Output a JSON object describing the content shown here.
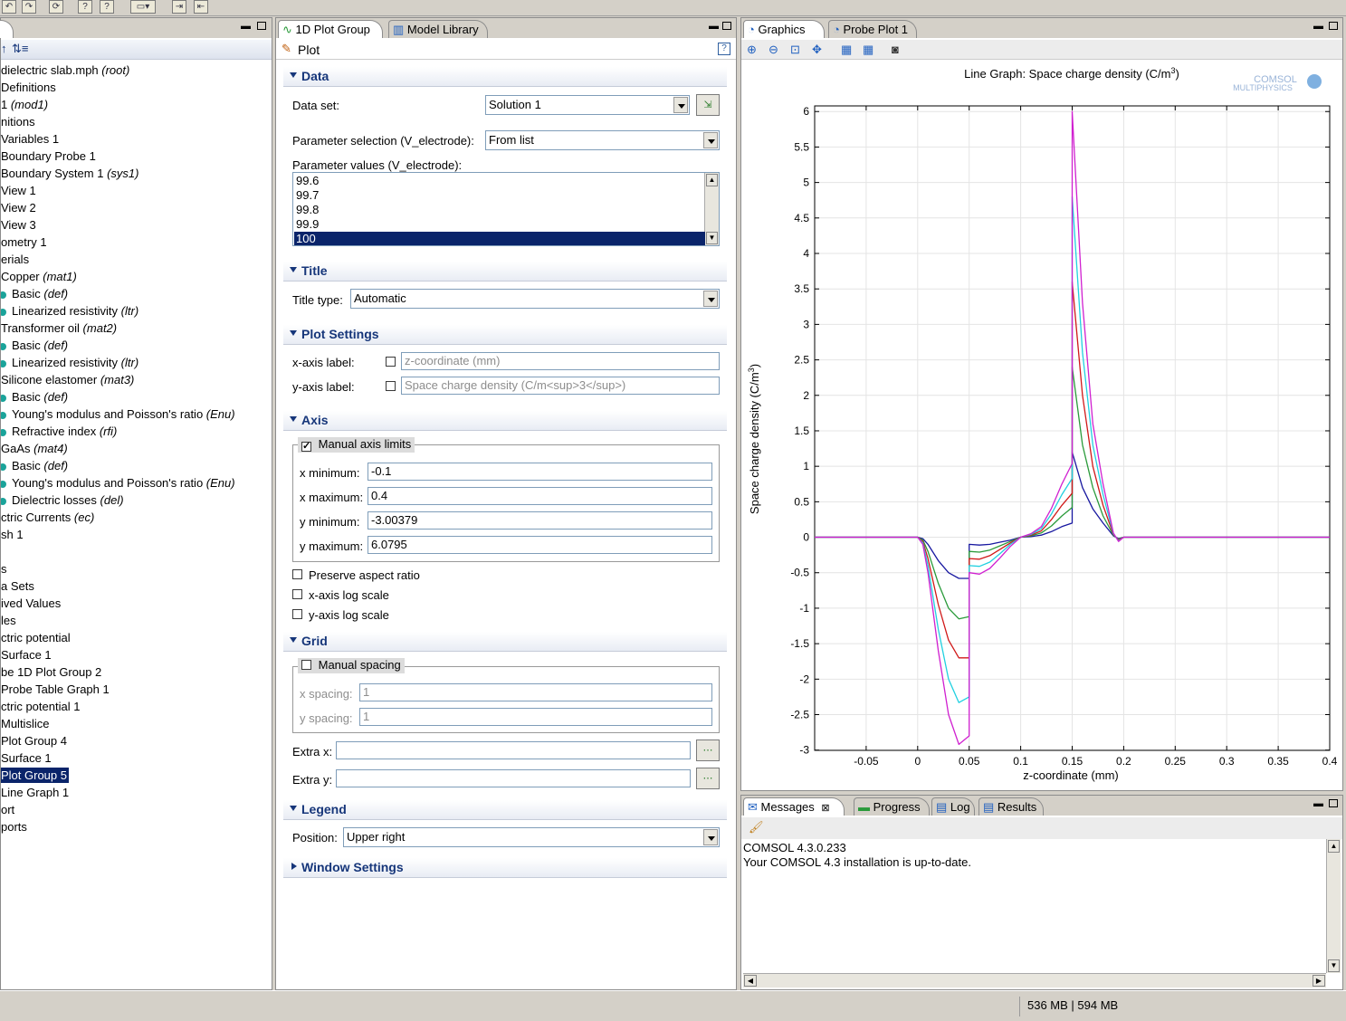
{
  "toolbar": {
    "buttons": [
      "undo-icon",
      "redo-icon",
      "refresh-icon",
      "help-icon",
      "help2-icon",
      "window-icon",
      "import-icon",
      "export-icon"
    ]
  },
  "model_builder": {
    "header_icons": [
      "arrow-icon",
      "sort-icon"
    ],
    "tree": [
      {
        "text": "dielectric slab.mph",
        "suffix": "(root)",
        "leaf": false
      },
      {
        "text": "Definitions",
        "suffix": "",
        "leaf": false
      },
      {
        "text": "1",
        "suffix": "(mod1)",
        "leaf": false
      },
      {
        "text": "nitions",
        "suffix": "",
        "leaf": false
      },
      {
        "text": "Variables 1",
        "suffix": "",
        "leaf": false
      },
      {
        "text": "Boundary Probe 1",
        "suffix": "",
        "leaf": false
      },
      {
        "text": "Boundary System 1",
        "suffix": "(sys1)",
        "leaf": false
      },
      {
        "text": "View 1",
        "suffix": "",
        "leaf": false
      },
      {
        "text": "View 2",
        "suffix": "",
        "leaf": false
      },
      {
        "text": "View 3",
        "suffix": "",
        "leaf": false
      },
      {
        "text": "ometry 1",
        "suffix": "",
        "leaf": false
      },
      {
        "text": "erials",
        "suffix": "",
        "leaf": false
      },
      {
        "text": "Copper",
        "suffix": "(mat1)",
        "leaf": false
      },
      {
        "text": "Basic",
        "suffix": "(def)",
        "leaf": true
      },
      {
        "text": "Linearized resistivity",
        "suffix": "(ltr)",
        "leaf": true
      },
      {
        "text": "Transformer oil",
        "suffix": "(mat2)",
        "leaf": false
      },
      {
        "text": "Basic",
        "suffix": "(def)",
        "leaf": true
      },
      {
        "text": "Linearized resistivity",
        "suffix": "(ltr)",
        "leaf": true
      },
      {
        "text": "Silicone elastomer",
        "suffix": "(mat3)",
        "leaf": false
      },
      {
        "text": "Basic",
        "suffix": "(def)",
        "leaf": true
      },
      {
        "text": "Young's modulus and Poisson's ratio",
        "suffix": "(Enu)",
        "leaf": true
      },
      {
        "text": "Refractive index",
        "suffix": "(rfi)",
        "leaf": true
      },
      {
        "text": "GaAs",
        "suffix": "(mat4)",
        "leaf": false
      },
      {
        "text": "Basic",
        "suffix": "(def)",
        "leaf": true
      },
      {
        "text": "Young's modulus and Poisson's ratio",
        "suffix": "(Enu)",
        "leaf": true
      },
      {
        "text": "Dielectric losses",
        "suffix": "(del)",
        "leaf": true
      },
      {
        "text": "ctric Currents",
        "suffix": "(ec)",
        "leaf": false
      },
      {
        "text": "sh 1",
        "suffix": "",
        "leaf": false
      },
      {
        "text": "",
        "suffix": "",
        "leaf": false
      },
      {
        "text": "s",
        "suffix": "",
        "leaf": false
      },
      {
        "text": "a Sets",
        "suffix": "",
        "leaf": false
      },
      {
        "text": "ived Values",
        "suffix": "",
        "leaf": false
      },
      {
        "text": "les",
        "suffix": "",
        "leaf": false
      },
      {
        "text": "ctric potential",
        "suffix": "",
        "leaf": false
      },
      {
        "text": "Surface 1",
        "suffix": "",
        "leaf": false
      },
      {
        "text": "be 1D Plot Group 2",
        "suffix": "",
        "leaf": false
      },
      {
        "text": "Probe Table Graph 1",
        "suffix": "",
        "leaf": false
      },
      {
        "text": "ctric potential 1",
        "suffix": "",
        "leaf": false
      },
      {
        "text": "Multislice",
        "suffix": "",
        "leaf": false
      },
      {
        "text": "Plot Group 4",
        "suffix": "",
        "leaf": false
      },
      {
        "text": "Surface 1",
        "suffix": "",
        "leaf": false
      },
      {
        "text": "Plot Group 5",
        "suffix": "",
        "leaf": false,
        "selected": true
      },
      {
        "text": "Line Graph 1",
        "suffix": "",
        "leaf": false
      },
      {
        "text": "ort",
        "suffix": "",
        "leaf": false
      },
      {
        "text": "ports",
        "suffix": "",
        "leaf": false
      }
    ]
  },
  "settings": {
    "tabs": [
      "1D Plot Group",
      "Model Library"
    ],
    "header": "Plot",
    "data": {
      "section": "Data",
      "dataset_label": "Data set:",
      "dataset_value": "Solution 1",
      "param_sel_label": "Parameter selection (V_electrode):",
      "param_sel_value": "From list",
      "param_values_label": "Parameter values (V_electrode):",
      "param_values": [
        "99.6",
        "99.7",
        "99.8",
        "99.9",
        "100"
      ],
      "selected_value": "100"
    },
    "title": {
      "section": "Title",
      "label": "Title type:",
      "value": "Automatic"
    },
    "plot_settings": {
      "section": "Plot Settings",
      "x_label": "x-axis label:",
      "x_value": "z-coordinate (mm)",
      "y_label": "y-axis label:",
      "y_value": "Space charge density (C/m<sup>3</sup>)"
    },
    "axis": {
      "section": "Axis",
      "manual_limits": "Manual axis limits",
      "manual_checked": true,
      "xmin_label": "x minimum:",
      "xmin": "-0.1",
      "xmax_label": "x maximum:",
      "xmax": "0.4",
      "ymin_label": "y minimum:",
      "ymin": "-3.00379",
      "ymax_label": "y maximum:",
      "ymax": "6.0795",
      "preserve": "Preserve aspect ratio",
      "xlog": "x-axis log scale",
      "ylog": "y-axis log scale"
    },
    "grid": {
      "section": "Grid",
      "manual_spacing": "Manual spacing",
      "xs_label": "x spacing:",
      "xs": "1",
      "ys_label": "y spacing:",
      "ys": "1",
      "extrax_label": "Extra x:",
      "extray_label": "Extra y:"
    },
    "legend": {
      "section": "Legend",
      "label": "Position:",
      "value": "Upper right"
    },
    "window": {
      "section": "Window Settings"
    }
  },
  "graphics": {
    "tabs": [
      "Graphics",
      "Probe Plot 1"
    ],
    "toolbar_icons": [
      "zoom-in-icon",
      "zoom-out-icon",
      "zoom-box-icon",
      "zoom-extents-icon",
      "grid-icon",
      "grid2-icon",
      "camera-icon"
    ],
    "logo_line1": "COMSOL",
    "logo_line2": "MULTIPHYSICS"
  },
  "chart_data": {
    "type": "line",
    "title": "Line Graph: Space charge density (C/m",
    "title_sup": "3",
    "title_close": ")",
    "xlabel": "z-coordinate (mm)",
    "ylabel": "Space charge density (C/m",
    "ylabel_sup": "3",
    "ylabel_close": ")",
    "xlim": [
      -0.1,
      0.4
    ],
    "ylim": [
      -3.00379,
      6.0795
    ],
    "grid": true,
    "xticks": [
      -0.05,
      0,
      0.05,
      0.1,
      0.15,
      0.2,
      0.25,
      0.3,
      0.35,
      0.4
    ],
    "xtick_labels": [
      "-0.05",
      "0",
      "0.05",
      "0.1",
      "0.15",
      "0.2",
      "0.25",
      "0.3",
      "0.35",
      "0.4"
    ],
    "yticks": [
      -3,
      -2.5,
      -2,
      -1.5,
      -1,
      -0.5,
      0,
      0.5,
      1,
      1.5,
      2,
      2.5,
      3,
      3.5,
      4,
      4.5,
      5,
      5.5,
      6
    ],
    "ytick_labels": [
      "-3",
      "-2.5",
      "-2",
      "-1.5",
      "-1",
      "-0.5",
      "0",
      "0.5",
      "1",
      "1.5",
      "2",
      "2.5",
      "3",
      "3.5",
      "4",
      "4.5",
      "5",
      "5.5",
      "6"
    ],
    "series": [
      {
        "color": "#1818a0",
        "x": [
          -0.1,
          0,
          0.005,
          0.01,
          0.02,
          0.03,
          0.04,
          0.05,
          0.05,
          0.06,
          0.07,
          0.08,
          0.09,
          0.1,
          0.11,
          0.12,
          0.13,
          0.14,
          0.15,
          0.15,
          0.16,
          0.17,
          0.18,
          0.19,
          0.195,
          0.2,
          0.25,
          0.4
        ],
        "y": [
          0,
          0,
          -0.02,
          -0.1,
          -0.33,
          -0.5,
          -0.58,
          -0.58,
          -0.1,
          -0.11,
          -0.1,
          -0.07,
          -0.04,
          0,
          0.01,
          0.03,
          0.08,
          0.15,
          0.2,
          1.2,
          0.7,
          0.4,
          0.2,
          0.02,
          -0.02,
          0,
          0,
          0
        ]
      },
      {
        "color": "#2a9a3a",
        "x": [
          -0.1,
          0,
          0.005,
          0.01,
          0.02,
          0.03,
          0.04,
          0.05,
          0.05,
          0.06,
          0.07,
          0.08,
          0.09,
          0.1,
          0.11,
          0.12,
          0.13,
          0.14,
          0.15,
          0.15,
          0.16,
          0.17,
          0.18,
          0.19,
          0.195,
          0.2,
          0.25,
          0.4
        ],
        "y": [
          0,
          0,
          -0.04,
          -0.2,
          -0.65,
          -1.0,
          -1.15,
          -1.12,
          -0.2,
          -0.21,
          -0.18,
          -0.12,
          -0.06,
          0,
          0.02,
          0.06,
          0.16,
          0.3,
          0.42,
          2.4,
          1.3,
          0.7,
          0.3,
          0.03,
          -0.03,
          0,
          0,
          0
        ]
      },
      {
        "color": "#d01818",
        "x": [
          -0.1,
          0,
          0.005,
          0.01,
          0.02,
          0.03,
          0.04,
          0.05,
          0.05,
          0.06,
          0.07,
          0.08,
          0.09,
          0.1,
          0.11,
          0.12,
          0.13,
          0.14,
          0.15,
          0.15,
          0.16,
          0.17,
          0.18,
          0.19,
          0.195,
          0.2,
          0.25,
          0.4
        ],
        "y": [
          0,
          0,
          -0.06,
          -0.3,
          -0.95,
          -1.45,
          -1.7,
          -1.7,
          -0.3,
          -0.31,
          -0.26,
          -0.17,
          -0.08,
          0,
          0.03,
          0.09,
          0.25,
          0.45,
          0.62,
          3.6,
          2.0,
          1.0,
          0.45,
          0.04,
          -0.04,
          0,
          0,
          0
        ]
      },
      {
        "color": "#20d0e0",
        "x": [
          -0.1,
          0,
          0.005,
          0.01,
          0.02,
          0.03,
          0.04,
          0.05,
          0.05,
          0.06,
          0.07,
          0.08,
          0.09,
          0.1,
          0.11,
          0.12,
          0.13,
          0.14,
          0.15,
          0.15,
          0.16,
          0.17,
          0.18,
          0.19,
          0.195,
          0.2,
          0.25,
          0.4
        ],
        "y": [
          0,
          0,
          -0.08,
          -0.4,
          -1.3,
          -2.0,
          -2.33,
          -2.25,
          -0.4,
          -0.41,
          -0.35,
          -0.23,
          -0.1,
          0,
          0.04,
          0.12,
          0.33,
          0.6,
          0.83,
          4.8,
          2.6,
          1.3,
          0.6,
          0.05,
          -0.05,
          0,
          0,
          0
        ]
      },
      {
        "color": "#d020d0",
        "x": [
          -0.1,
          0,
          0.005,
          0.01,
          0.02,
          0.03,
          0.04,
          0.05,
          0.05,
          0.06,
          0.07,
          0.08,
          0.09,
          0.1,
          0.11,
          0.12,
          0.13,
          0.14,
          0.15,
          0.15,
          0.16,
          0.17,
          0.18,
          0.19,
          0.195,
          0.2,
          0.25,
          0.4
        ],
        "y": [
          0,
          0,
          -0.1,
          -0.5,
          -1.6,
          -2.5,
          -2.92,
          -2.8,
          -0.5,
          -0.52,
          -0.44,
          -0.29,
          -0.13,
          0,
          0.05,
          0.15,
          0.41,
          0.75,
          1.04,
          6.0,
          3.3,
          1.6,
          0.75,
          0.06,
          -0.06,
          0,
          0,
          0
        ]
      }
    ]
  },
  "messages": {
    "tabs": [
      "Messages",
      "Progress",
      "Log",
      "Results"
    ],
    "lines": [
      "COMSOL 4.3.0.233",
      "Your COMSOL 4.3 installation is up-to-date."
    ]
  },
  "status": {
    "memory": "536 MB | 594 MB"
  }
}
